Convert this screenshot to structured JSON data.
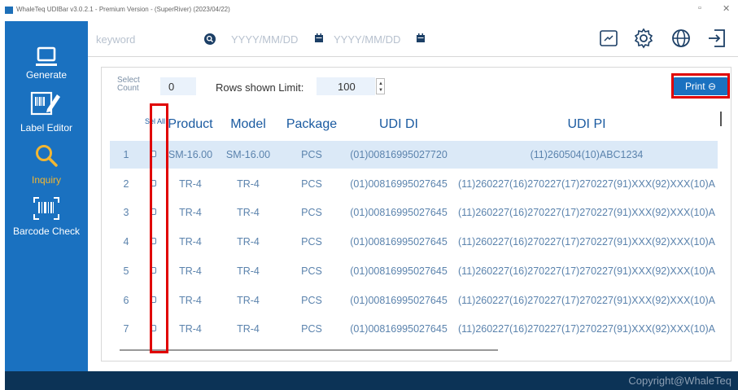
{
  "window": {
    "title": "WhaleTeq UDIBar v3.0.2.1 - Premium Version - (SuperRiver) (2023/04/22)",
    "minimize_glyph": "▫",
    "close_glyph": "✕"
  },
  "sidebar": {
    "items": [
      {
        "label": "Generate",
        "icon": "laptop-icon"
      },
      {
        "label": "Label Editor",
        "icon": "label-edit-icon"
      },
      {
        "label": "Inquiry",
        "icon": "search-icon",
        "active": true
      },
      {
        "label": "Barcode Check",
        "icon": "barcode-scan-icon"
      }
    ]
  },
  "toolbar": {
    "keyword_placeholder": "keyword",
    "date_from_placeholder": "YYYY/MM/DD",
    "date_to_placeholder": "YYYY/MM/DD",
    "icons": [
      "search-icon",
      "calendar-icon",
      "calendar-icon",
      "export-icon",
      "settings-icon",
      "language-icon",
      "logout-icon"
    ]
  },
  "controls": {
    "select_count_label": "Select Count",
    "select_count_value": "0",
    "rows_limit_label": "Rows shown Limit:",
    "rows_limit_value": "100",
    "print_label": "Print ⊖"
  },
  "table": {
    "headers": {
      "select_all": "Sel All",
      "product": "Product",
      "model": "Model",
      "package": "Package",
      "udi_di": "UDI DI",
      "udi_pi": "UDI PI"
    },
    "rows": [
      {
        "n": "1",
        "product": "SM-16.00",
        "model": "SM-16.00",
        "package": "PCS",
        "udi_di": "(01)00816995027720",
        "udi_pi": "(11)260504(10)ABC1234"
      },
      {
        "n": "2",
        "product": "TR-4",
        "model": "TR-4",
        "package": "PCS",
        "udi_di": "(01)00816995027645",
        "udi_pi": "(11)260227(16)270227(17)270227(91)XXX(92)XXX(10)A"
      },
      {
        "n": "3",
        "product": "TR-4",
        "model": "TR-4",
        "package": "PCS",
        "udi_di": "(01)00816995027645",
        "udi_pi": "(11)260227(16)270227(17)270227(91)XXX(92)XXX(10)A"
      },
      {
        "n": "4",
        "product": "TR-4",
        "model": "TR-4",
        "package": "PCS",
        "udi_di": "(01)00816995027645",
        "udi_pi": "(11)260227(16)270227(17)270227(91)XXX(92)XXX(10)A"
      },
      {
        "n": "5",
        "product": "TR-4",
        "model": "TR-4",
        "package": "PCS",
        "udi_di": "(01)00816995027645",
        "udi_pi": "(11)260227(16)270227(17)270227(91)XXX(92)XXX(10)A"
      },
      {
        "n": "6",
        "product": "TR-4",
        "model": "TR-4",
        "package": "PCS",
        "udi_di": "(01)00816995027645",
        "udi_pi": "(11)260227(16)270227(17)270227(91)XXX(92)XXX(10)A"
      },
      {
        "n": "7",
        "product": "TR-4",
        "model": "TR-4",
        "package": "PCS",
        "udi_di": "(01)00816995027645",
        "udi_pi": "(11)260227(16)270227(17)270227(91)XXX(92)XXX(10)A"
      }
    ]
  },
  "footer": {
    "copyright": "Copyright@WhaleTeq"
  },
  "colors": {
    "sidebar": "#1a71c0",
    "footer": "#0c3356",
    "accent_active": "#f2b632",
    "highlight": "#e00000",
    "selected_row": "#dbe9f7"
  }
}
